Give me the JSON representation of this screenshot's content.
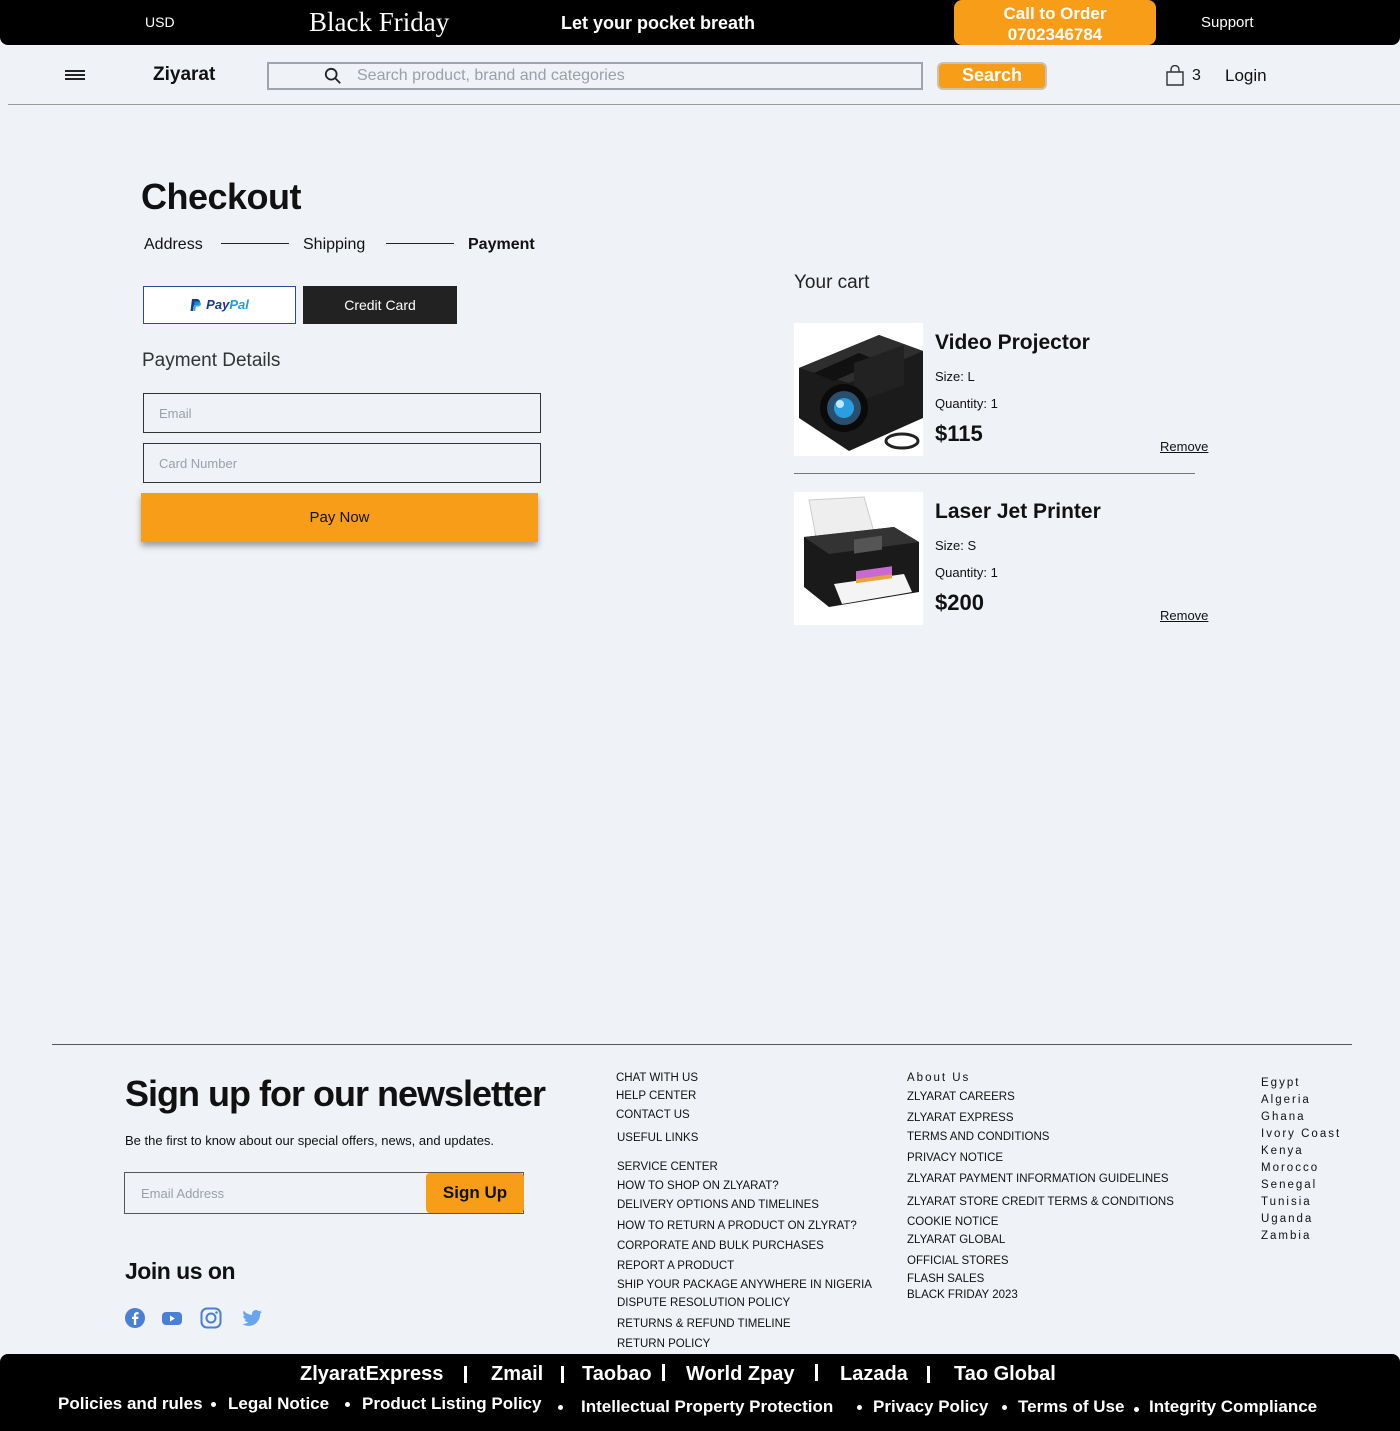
{
  "topbar": {
    "currency": "USD",
    "promo": "Black Friday",
    "tagline": "Let your pocket breath",
    "call_label": "Call to Order",
    "call_number": "0702346784",
    "support": "Support"
  },
  "header": {
    "logo": "Ziyarat",
    "search_placeholder": "Search product, brand and categories",
    "search_button": "Search",
    "cart_count": "3",
    "login": "Login",
    "icons": [
      "menu-icon",
      "search-icon",
      "shopping-bag-icon"
    ]
  },
  "checkout": {
    "title": "Checkout",
    "steps": [
      "Address",
      "Shipping",
      "Payment"
    ],
    "active_step": "Payment",
    "payment_tabs": {
      "paypal_a": "Pay",
      "paypal_b": "Pal",
      "credit": "Credit Card"
    },
    "details_title": "Payment Details",
    "email_placeholder": "Email",
    "card_placeholder": "Card Number",
    "pay_button": "Pay Now"
  },
  "cart": {
    "title": "Your cart",
    "items": [
      {
        "name": "Video Projector",
        "size": "Size: L",
        "quantity": "Quantity: 1",
        "price": "$115",
        "remove": "Remove",
        "image": "projector-image"
      },
      {
        "name": "Laser Jet Printer",
        "size": "Size: S",
        "quantity": "Quantity: 1",
        "price": "$200",
        "remove": "Remove",
        "image": "printer-image"
      }
    ]
  },
  "newsletter": {
    "title": "Sign up for our newsletter",
    "subtitle": "Be the first to know about our special offers, news, and updates.",
    "email_placeholder": "Email Address",
    "button": "Sign Up",
    "join": "Join us on",
    "social": [
      "facebook-icon",
      "youtube-icon",
      "instagram-icon",
      "twitter-icon"
    ]
  },
  "footer": {
    "col1": [
      "CHAT WITH US",
      "HELP CENTER",
      "CONTACT US",
      "USEFUL LINKS",
      "SERVICE CENTER",
      "HOW TO SHOP ON  ZLYARAT?",
      "DELIVERY OPTIONS AND TIMELINES",
      "HOW TO RETURN A PRODUCT ON ZLYRAT?",
      "CORPORATE AND BULK PURCHASES",
      "REPORT A PRODUCT",
      "SHIP YOUR PACKAGE ANYWHERE IN NIGERIA",
      "DISPUTE RESOLUTION POLICY",
      "RETURNS & REFUND TIMELINE",
      "RETURN POLICY"
    ],
    "col2": [
      "About Us",
      "ZLYARAT CAREERS",
      "ZLYARAT EXPRESS",
      "TERMS AND CONDITIONS",
      "PRIVACY NOTICE",
      "ZLYARAT PAYMENT INFORMATION GUIDELINES",
      "ZLYARAT STORE CREDIT TERMS & CONDITIONS",
      "COOKIE NOTICE",
      "ZLYARAT GLOBAL",
      "OFFICIAL STORES",
      "FLASH SALES",
      "BLACK FRIDAY 2023"
    ],
    "countries": [
      "Egypt",
      "Algeria",
      "Ghana",
      "Ivory Coast",
      "Kenya",
      "Morocco",
      "Senegal",
      "Tunisia",
      "Uganda",
      "Zambia"
    ]
  },
  "bottombar": {
    "row1": [
      "ZlyaratExpress",
      "Zmail",
      "Taobao",
      "World Zpay",
      "Lazada",
      "Tao Global"
    ],
    "row2": [
      "Policies and rules",
      "Legal Notice",
      "Product Listing Policy",
      "Intellectual Property Protection",
      "Privacy Policy",
      "Terms of Use",
      "Integrity Compliance"
    ]
  }
}
